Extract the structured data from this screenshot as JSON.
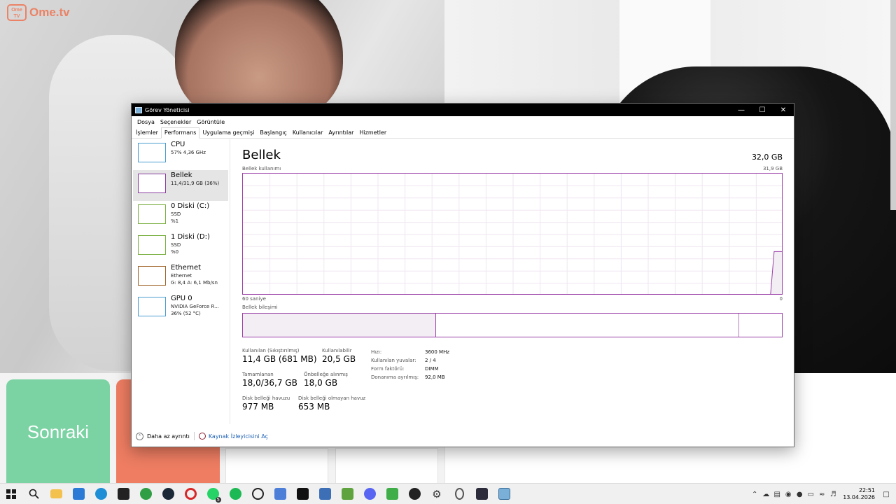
{
  "background": {
    "logo_text": "Ome.tv",
    "logo_badge": "Ome TV",
    "next_button_label": "Sonraki",
    "colors": {
      "next_button": "#7bd3a3",
      "stop_button": "#ee7d62",
      "logo": "#f06e4a"
    }
  },
  "window": {
    "title": "Görev Yöneticisi",
    "menu": [
      "Dosya",
      "Seçenekler",
      "Görüntüle"
    ],
    "tabs": [
      "İşlemler",
      "Performans",
      "Uygulama geçmişi",
      "Başlangıç",
      "Kullanıcılar",
      "Ayrıntılar",
      "Hizmetler"
    ],
    "active_tab": "Performans"
  },
  "sidebar": {
    "items": [
      {
        "name": "CPU",
        "lines": [
          "57% 4,36 GHz"
        ],
        "color": "#4a9ccf",
        "selected": false
      },
      {
        "name": "Bellek",
        "lines": [
          "11,4/31,9 GB (36%)"
        ],
        "color": "#8a3ea0",
        "selected": true
      },
      {
        "name": "0 Diski (C:)",
        "lines": [
          "SSD",
          "%1"
        ],
        "color": "#7bb043",
        "selected": false
      },
      {
        "name": "1 Diski (D:)",
        "lines": [
          "SSD",
          "%0"
        ],
        "color": "#7bb043",
        "selected": false
      },
      {
        "name": "Ethernet",
        "lines": [
          "Ethernet",
          "G: 8,4  A: 6,1 Mb/sn"
        ],
        "color": "#a0652c",
        "selected": false
      },
      {
        "name": "GPU 0",
        "lines": [
          "NVIDIA GeForce R...",
          "36% (52 °C)"
        ],
        "color": "#4a9ccf",
        "selected": false
      }
    ]
  },
  "memory": {
    "title": "Bellek",
    "total": "32,0 GB",
    "usage_label": "Bellek kullanımı",
    "usage_max": "31,9 GB",
    "time_left": "60 saniye",
    "time_right": "0",
    "composition_label": "Bellek bileşimi",
    "composition": {
      "in_use_fraction": 0.358,
      "modified_fraction": 0.92
    },
    "usage_history_fraction": [
      0,
      0,
      0,
      0,
      0,
      0,
      0,
      0,
      0,
      0,
      0,
      0,
      0,
      0,
      0,
      0,
      0,
      0,
      0,
      0,
      0,
      0,
      0,
      0,
      0,
      0,
      0,
      0,
      0,
      0,
      0,
      0,
      0,
      0,
      0,
      0,
      0,
      0,
      0,
      0,
      0,
      0,
      0,
      0,
      0,
      0,
      0,
      0,
      0,
      0,
      0,
      0,
      0,
      0,
      0,
      0,
      0,
      0,
      0.36,
      0.36
    ],
    "colors": {
      "accent": "#9b3fa8",
      "fill": "#f3eef4"
    },
    "stats": [
      {
        "key": "Kullanılan (Sıkıştırılmış)",
        "value": "11,4 GB (681 MB)"
      },
      {
        "key": "Kullanılabilir",
        "value": "20,5 GB"
      },
      {
        "key": "Tamamlanan",
        "value": "18,0/36,7 GB"
      },
      {
        "key": "Önbelleğe alınmış",
        "value": "18,0 GB"
      },
      {
        "key": "Disk belleği havuzu",
        "value": "977 MB"
      },
      {
        "key": "Disk belleği olmayan havuz",
        "value": "653 MB"
      }
    ],
    "properties": [
      {
        "key": "Hızı:",
        "value": "3600 MHz"
      },
      {
        "key": "Kullanılan yuvalar:",
        "value": "2 / 4"
      },
      {
        "key": "Form faktörü:",
        "value": "DIMM"
      },
      {
        "key": "Donanıma ayrılmış:",
        "value": "92,0 MB"
      }
    ]
  },
  "footer": {
    "fewer_details": "Daha az ayrıntı",
    "resource_monitor": "Kaynak İzleyicisini Aç"
  },
  "taskbar": {
    "icons": [
      "windows-start",
      "search",
      "file-explorer",
      "store",
      "edge",
      "epic-games",
      "xbox",
      "steam",
      "opera",
      "whatsapp",
      "spotify",
      "chatgpt",
      "app-blue",
      "capcut",
      "calculator",
      "minecraft",
      "discord",
      "app-green",
      "obs",
      "settings",
      "app-white",
      "app-dark",
      "task-manager"
    ],
    "whatsapp_badge": "5",
    "time": "22:51",
    "date": "13.04.2026"
  }
}
